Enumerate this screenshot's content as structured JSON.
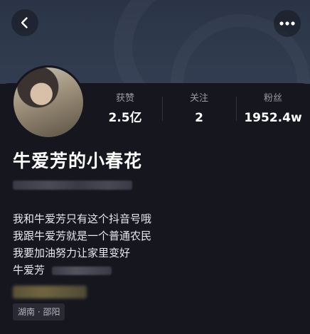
{
  "header": {
    "back_icon": "chevron-left-icon",
    "more_icon": "more-horizontal-icon"
  },
  "profile": {
    "name": "牛爱芳的小春花",
    "stats": [
      {
        "label": "获赞",
        "value": "2.5亿"
      },
      {
        "label": "关注",
        "value": "2"
      },
      {
        "label": "粉丝",
        "value": "1952.4w"
      }
    ],
    "bio_lines": [
      "我和牛爱芳只有这个抖音号哦",
      "我跟牛爱芳就是一个普通农民",
      "我要加油努力让家里变好",
      "牛爱芳"
    ],
    "location_tag": "湖南 · 邵阳"
  },
  "colors": {
    "background": "#16161f",
    "banner": "#2f3a4d",
    "muted_text": "#9a9aa6",
    "tag_bg": "#2a2a35"
  }
}
